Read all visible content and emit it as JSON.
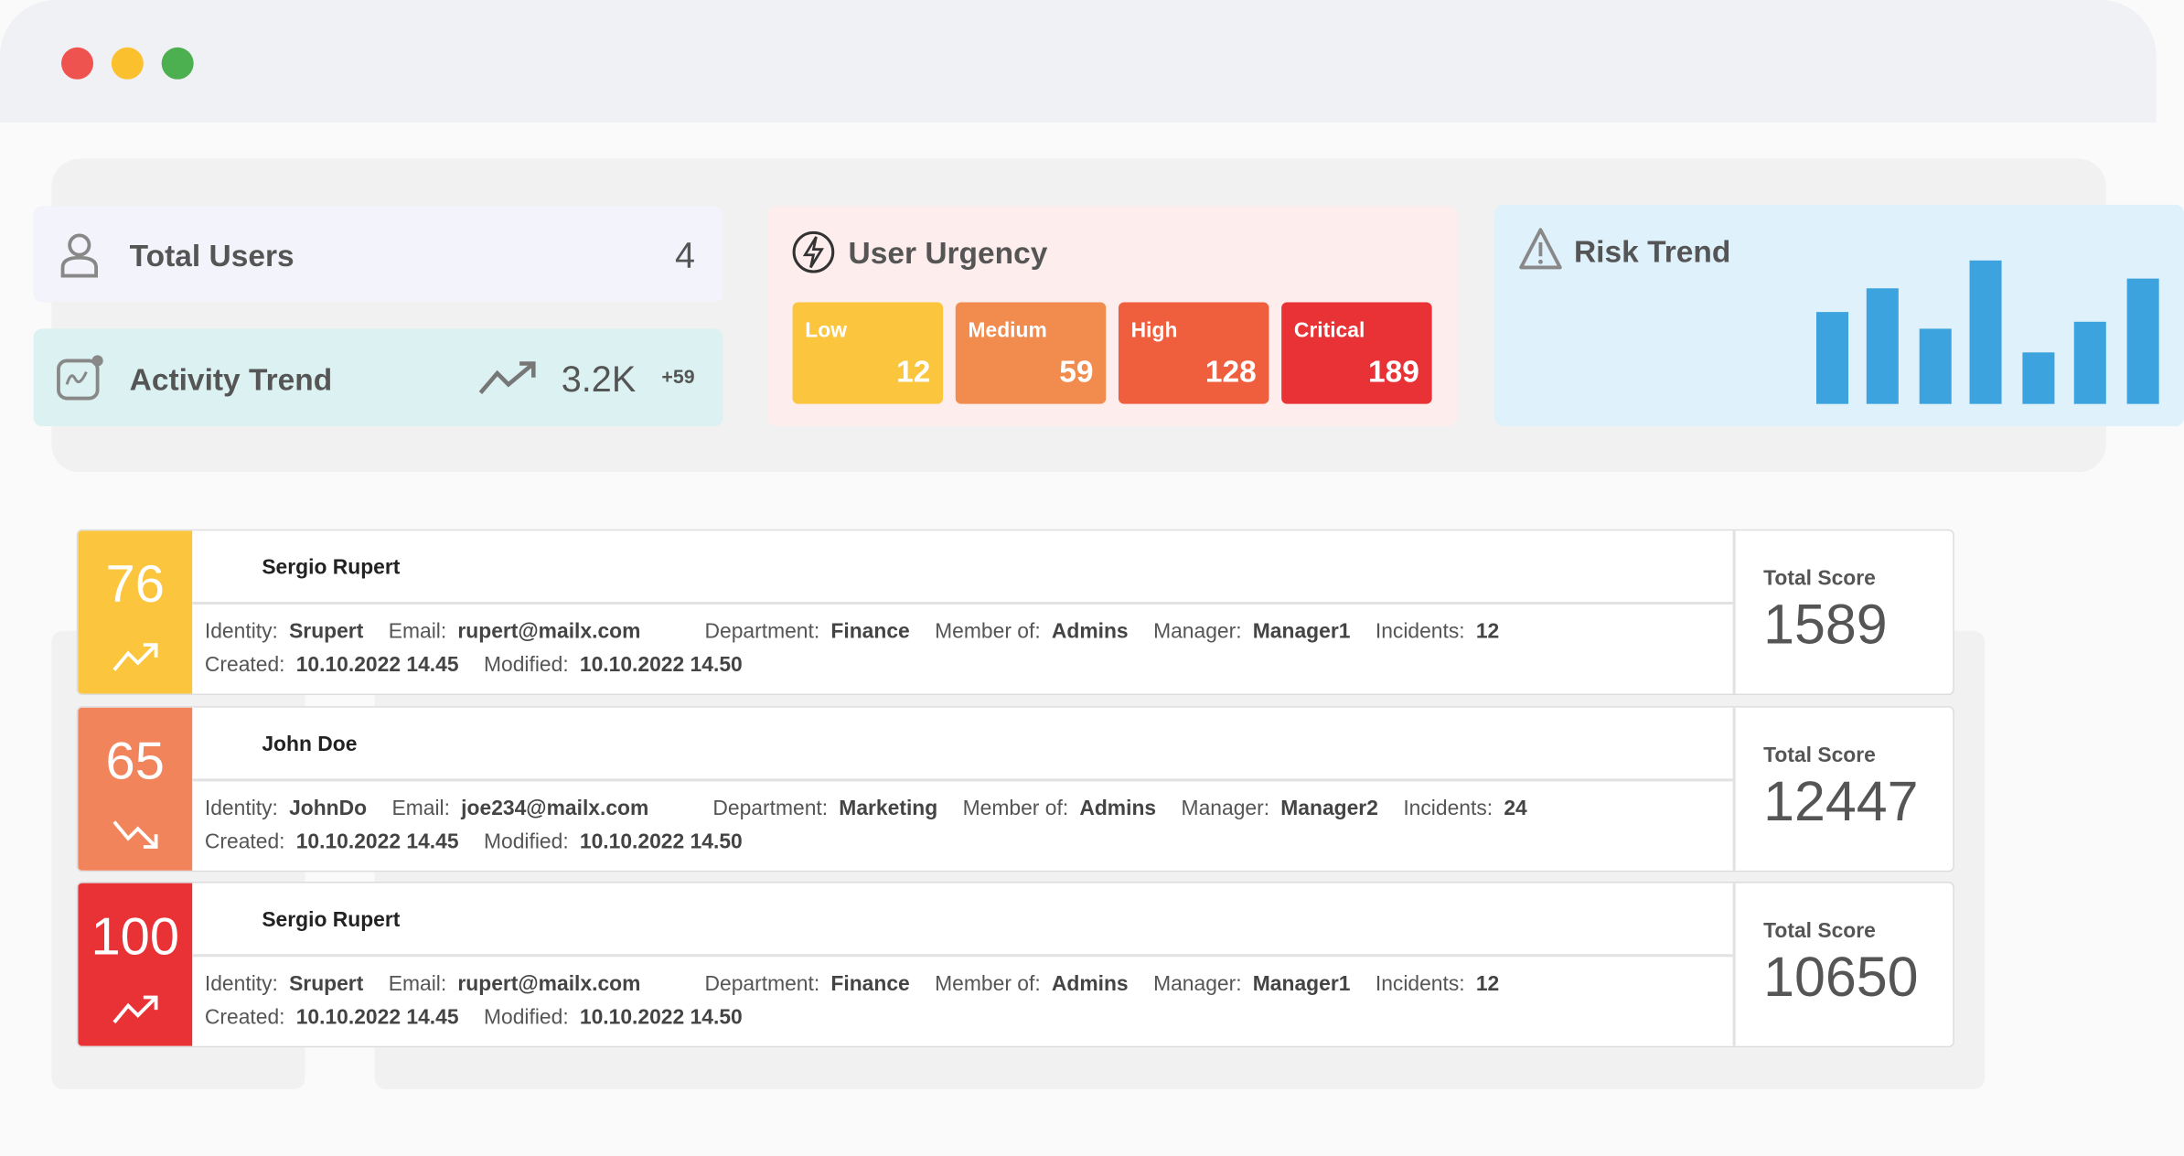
{
  "window": {
    "controls": [
      {
        "name": "close",
        "color": "#ef5350"
      },
      {
        "name": "minimize",
        "color": "#fbc02d"
      },
      {
        "name": "maximize",
        "color": "#4caf50"
      }
    ]
  },
  "total_users": {
    "title": "Total Users",
    "value": "4",
    "icon": "user-icon"
  },
  "activity_trend": {
    "title": "Activity Trend",
    "value": "3.2K",
    "delta": "+59",
    "icon": "activity-chart-icon",
    "trend_icon": "trend-up-icon"
  },
  "user_urgency": {
    "title": "User Urgency",
    "icon": "lightning-icon",
    "levels": [
      {
        "label": "Low",
        "value": "12",
        "color": "#fbc63e"
      },
      {
        "label": "Medium",
        "value": "59",
        "color": "#f28c4e"
      },
      {
        "label": "High",
        "value": "128",
        "color": "#ef5f3e"
      },
      {
        "label": "Critical",
        "value": "189",
        "color": "#e93235"
      }
    ]
  },
  "risk_trend": {
    "title": "Risk Trend",
    "icon": "warning-icon"
  },
  "chart_data": {
    "type": "bar",
    "values": [
      64,
      81,
      52,
      100,
      36,
      57,
      87
    ],
    "color": "#3ca3de",
    "grid": false,
    "axes": false
  },
  "labels": {
    "identity": "Identity:",
    "email": "Email:",
    "department": "Department:",
    "member_of": "Member of:",
    "manager": "Manager:",
    "incidents": "Incidents:",
    "created": "Created:",
    "modified": "Modified:",
    "total_score": "Total Score"
  },
  "users": [
    {
      "score": "76",
      "color": "#fbc63e",
      "trend": "up",
      "name": "Sergio Rupert",
      "identity": "Srupert",
      "email": "rupert@mailx.com",
      "department": "Finance",
      "member_of": "Admins",
      "manager": "Manager1",
      "incidents": "12",
      "created": "10.10.2022 14.45",
      "modified": "10.10.2022 14.50",
      "total_score": "1589"
    },
    {
      "score": "65",
      "color": "#f2845c",
      "trend": "down",
      "name": "John Doe",
      "identity": "JohnDo",
      "email": "joe234@mailx.com",
      "department": "Marketing",
      "member_of": "Admins",
      "manager": "Manager2",
      "incidents": "24",
      "created": "10.10.2022 14.45",
      "modified": "10.10.2022 14.50",
      "total_score": "12447"
    },
    {
      "score": "100",
      "color": "#e93235",
      "trend": "up",
      "name": "Sergio Rupert",
      "identity": "Srupert",
      "email": "rupert@mailx.com",
      "department": "Finance",
      "member_of": "Admins",
      "manager": "Manager1",
      "incidents": "12",
      "created": "10.10.2022 14.45",
      "modified": "10.10.2022 14.50",
      "total_score": "10650"
    }
  ]
}
